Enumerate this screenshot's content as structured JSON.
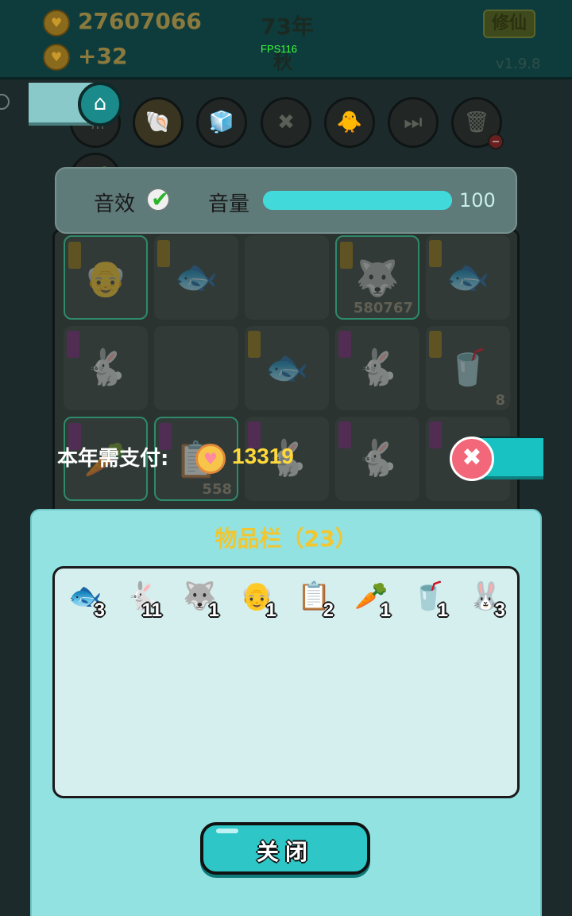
{
  "hud": {
    "coins": "27607066",
    "income": "+32",
    "year": "73年",
    "season": "秋",
    "fps": "FPS116",
    "xiuxian_label": "修仙",
    "version": "v1.9.8"
  },
  "settings": {
    "sound_label": "音效",
    "sound_enabled": true,
    "volume_label": "音量",
    "volume_value": "100",
    "volume_fraction": 1.0
  },
  "payment": {
    "label": "本年需支付:",
    "amount": "13319"
  },
  "backpack_grid": {
    "cells": [
      {
        "icon": "👴",
        "count": ""
      },
      {
        "icon": "🐟",
        "count": ""
      },
      {
        "icon": "",
        "count": ""
      },
      {
        "icon": "🐺",
        "count": "580767"
      },
      {
        "icon": "🐟",
        "count": ""
      },
      {
        "icon": "🐇",
        "count": ""
      },
      {
        "icon": "",
        "count": ""
      },
      {
        "icon": "🐟",
        "count": ""
      },
      {
        "icon": "🐇",
        "count": ""
      },
      {
        "icon": "🥤",
        "count": "8"
      },
      {
        "icon": "🥕",
        "count": ""
      },
      {
        "icon": "📋",
        "count": "558"
      },
      {
        "icon": "🐇",
        "count": ""
      },
      {
        "icon": "🐇",
        "count": ""
      },
      {
        "icon": "🐇",
        "count": ""
      }
    ]
  },
  "inventory": {
    "title": "物品栏（23）",
    "items": [
      {
        "icon": "🐟",
        "qty": "3"
      },
      {
        "icon": "🐇",
        "qty": "11"
      },
      {
        "icon": "🐺",
        "qty": "1"
      },
      {
        "icon": "👴",
        "qty": "1"
      },
      {
        "icon": "📋",
        "qty": "2"
      },
      {
        "icon": "🥕",
        "qty": "1"
      },
      {
        "icon": "🥤",
        "qty": "1"
      },
      {
        "icon": "🐰",
        "qty": "3"
      }
    ],
    "close_label": "关闭"
  },
  "colors": {
    "accent": "#2ec6c6",
    "panel": "#92e2e2",
    "gold": "#f2c62e",
    "close_red": "#f3677a"
  }
}
